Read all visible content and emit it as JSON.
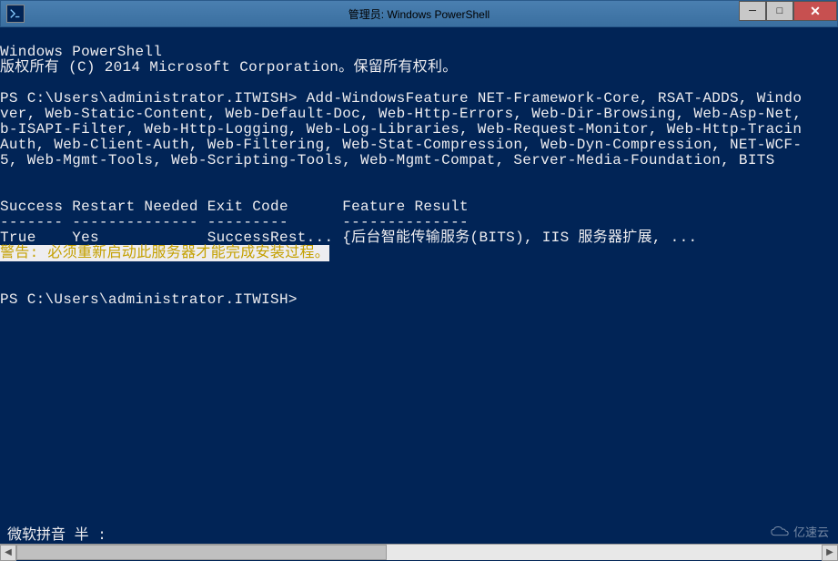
{
  "window": {
    "title": "管理员: Windows PowerShell"
  },
  "terminal": {
    "header1": "Windows PowerShell",
    "header2": "版权所有 (C) 2014 Microsoft Corporation。保留所有权利。",
    "blank": "",
    "cmd1": "PS C:\\Users\\administrator.ITWISH> Add-WindowsFeature NET-Framework-Core, RSAT-ADDS, Windo",
    "cmd2": "ver, Web-Static-Content, Web-Default-Doc, Web-Http-Errors, Web-Dir-Browsing, Web-Asp-Net,",
    "cmd3": "b-ISAPI-Filter, Web-Http-Logging, Web-Log-Libraries, Web-Request-Monitor, Web-Http-Tracin",
    "cmd4": "Auth, Web-Client-Auth, Web-Filtering, Web-Stat-Compression, Web-Dyn-Compression, NET-WCF-",
    "cmd5": "5, Web-Mgmt-Tools, Web-Scripting-Tools, Web-Mgmt-Compat, Server-Media-Foundation, BITS",
    "tableHeader": "Success Restart Needed Exit Code      Feature Result",
    "tableSep": "------- -------------- ---------      --------------",
    "tableRow": "True    Yes            SuccessRest... {后台智能传输服务(BITS), IIS 服务器扩展, ...",
    "warning": "警告: 必须重新启动此服务器才能完成安装过程。",
    "prompt2": "PS C:\\Users\\administrator.ITWISH>",
    "ime": "微软拼音 半 :"
  },
  "watermark": {
    "text": "亿速云"
  }
}
